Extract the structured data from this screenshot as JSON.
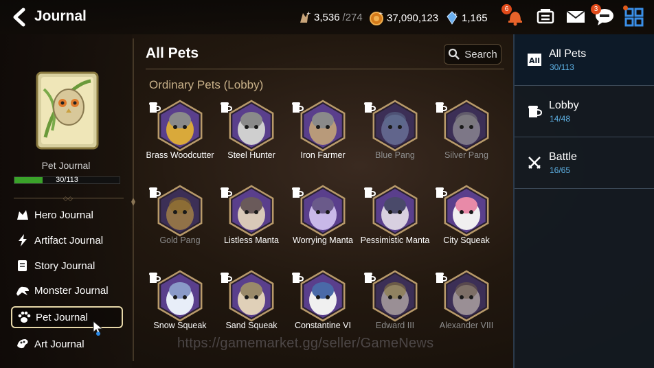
{
  "header": {
    "title": "Journal",
    "resources": [
      {
        "icon": "stamina-icon",
        "value": "3,536",
        "max": "/274"
      },
      {
        "icon": "gold-coin-icon",
        "value": "37,090,123"
      },
      {
        "icon": "crystal-icon",
        "value": "1,165"
      }
    ],
    "notifications_badge": "6",
    "chat_badge": "3"
  },
  "left_panel": {
    "journal_label": "Pet Journal",
    "progress_text": "30/113",
    "progress_fraction": 0.265,
    "nav": [
      {
        "label": "Hero Journal",
        "icon": "hero-icon"
      },
      {
        "label": "Artifact Journal",
        "icon": "artifact-icon"
      },
      {
        "label": "Story Journal",
        "icon": "story-icon"
      },
      {
        "label": "Monster Journal",
        "icon": "monster-icon"
      },
      {
        "label": "Pet Journal",
        "icon": "paw-icon"
      },
      {
        "label": "Art Journal",
        "icon": "art-icon"
      }
    ]
  },
  "main": {
    "title": "All Pets",
    "search_label": "Search",
    "section_title": "Ordinary Pets (Lobby)",
    "pets": [
      {
        "name": "Brass Woodcutter",
        "locked": false,
        "colors": [
          "#5a3f8c",
          "#d9a93a",
          "#8a8a8a"
        ]
      },
      {
        "name": "Steel Hunter",
        "locked": false,
        "colors": [
          "#5a3f8c",
          "#cfcfcf",
          "#8a8a8a"
        ]
      },
      {
        "name": "Iron Farmer",
        "locked": false,
        "colors": [
          "#5a3f8c",
          "#b89a7a",
          "#8a8a8a"
        ]
      },
      {
        "name": "Blue Pang",
        "locked": true,
        "colors": [
          "#4a3a70",
          "#7a8ab0",
          "#5a6a8a"
        ]
      },
      {
        "name": "Silver Pang",
        "locked": true,
        "colors": [
          "#4a3a70",
          "#a8a8a8",
          "#7a7a7a"
        ]
      },
      {
        "name": "Gold Pang",
        "locked": true,
        "colors": [
          "#4a3a70",
          "#c9a040",
          "#8a6a2a"
        ]
      },
      {
        "name": "Listless Manta",
        "locked": false,
        "colors": [
          "#5a3f8c",
          "#d8c8b8",
          "#6a5a5a"
        ]
      },
      {
        "name": "Worrying Manta",
        "locked": false,
        "colors": [
          "#5a3f8c",
          "#c8b8e8",
          "#6a5a8a"
        ]
      },
      {
        "name": "Pessimistic Manta",
        "locked": false,
        "colors": [
          "#5a3f8c",
          "#d8d0e0",
          "#4a4a6a"
        ]
      },
      {
        "name": "City Squeak",
        "locked": false,
        "colors": [
          "#5a3f8c",
          "#f0f0f0",
          "#e88aa8"
        ]
      },
      {
        "name": "Snow Squeak",
        "locked": false,
        "colors": [
          "#5a3f8c",
          "#e8eef8",
          "#8a9ac8"
        ]
      },
      {
        "name": "Sand Squeak",
        "locked": false,
        "colors": [
          "#5a3f8c",
          "#e0d0b8",
          "#9a8a6a"
        ]
      },
      {
        "name": "Constantine VI",
        "locked": false,
        "colors": [
          "#5a3f8c",
          "#f0f0f0",
          "#4a6aa8"
        ]
      },
      {
        "name": "Edward III",
        "locked": true,
        "colors": [
          "#4a3a70",
          "#d8d0c0",
          "#8a7a40"
        ]
      },
      {
        "name": "Alexander VIII",
        "locked": true,
        "colors": [
          "#4a3a70",
          "#d8d0c0",
          "#6a5a4a"
        ]
      }
    ]
  },
  "right_panel": {
    "tabs": [
      {
        "label": "All Pets",
        "count": "30/113",
        "icon": "all-icon"
      },
      {
        "label": "Lobby",
        "count": "14/48",
        "icon": "lobby-mug-icon"
      },
      {
        "label": "Battle",
        "count": "16/65",
        "icon": "crossed-swords-icon"
      }
    ]
  },
  "watermark": "https://gamemarket.gg/seller/GameNews"
}
